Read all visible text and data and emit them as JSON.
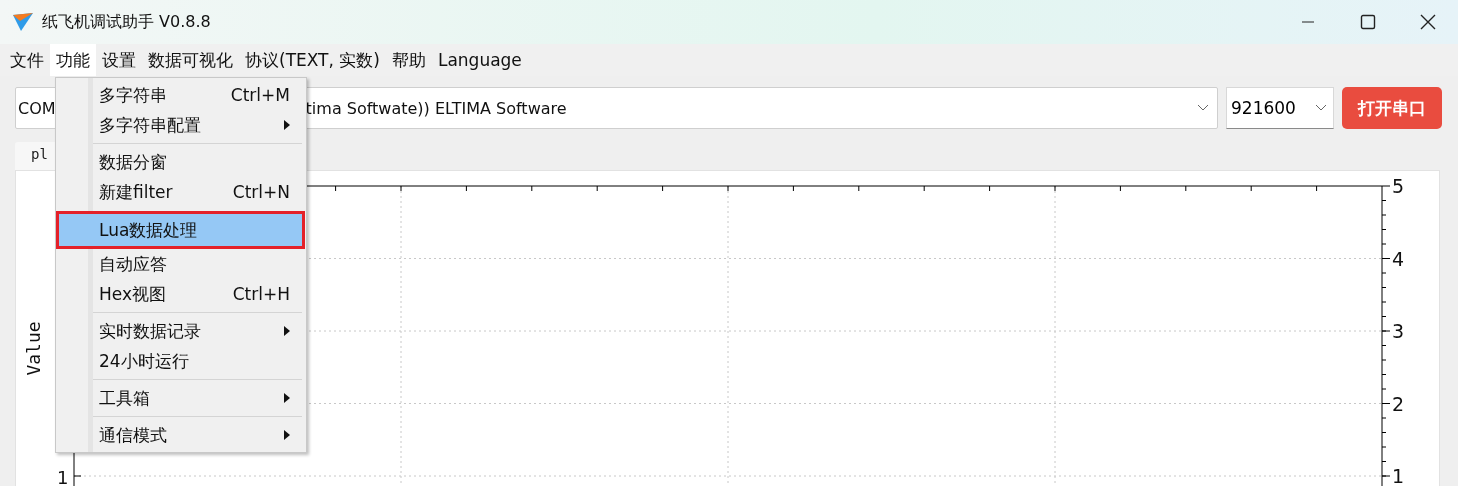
{
  "window": {
    "title": "纸飞机调试助手 V0.8.8"
  },
  "menu_bar": [
    {
      "label": "文件",
      "selected": false
    },
    {
      "label": "功能",
      "selected": true
    },
    {
      "label": "设置",
      "selected": false
    },
    {
      "label": "数据可视化",
      "selected": false
    },
    {
      "label": "协议(TEXT, 实数)",
      "selected": false
    },
    {
      "label": "帮助",
      "selected": false
    },
    {
      "label": "Language",
      "selected": false
    }
  ],
  "toolbar": {
    "port_value_start": "COM",
    "port_value_end": "tima Softwate)) ELTIMA Software",
    "baud_rate": "921600",
    "open_button": "打开串口"
  },
  "tabs": [
    {
      "label": "pl",
      "selected": true
    }
  ],
  "plot": {
    "y_axis_label": "Value",
    "right_axis_labels": [
      "5",
      "4",
      "3",
      "2",
      "1"
    ],
    "left_axis_labels": [
      "1"
    ]
  },
  "dropdown_menu": [
    {
      "kind": "item",
      "label": "多字符串",
      "shortcut": "Ctrl+M",
      "submenu": false,
      "selected": false
    },
    {
      "kind": "item",
      "label": "多字符串配置",
      "submenu": true,
      "selected": false
    },
    {
      "kind": "separator"
    },
    {
      "kind": "item",
      "label": "数据分窗",
      "submenu": false,
      "selected": false
    },
    {
      "kind": "item",
      "label": "新建filter",
      "shortcut": "Ctrl+N",
      "submenu": false,
      "selected": false
    },
    {
      "kind": "item",
      "label": "Lua数据处理",
      "submenu": false,
      "selected": true
    },
    {
      "kind": "item",
      "label": "自动应答",
      "submenu": false,
      "selected": false
    },
    {
      "kind": "item",
      "label": "Hex视图",
      "shortcut": "Ctrl+H",
      "submenu": false,
      "selected": false
    },
    {
      "kind": "separator"
    },
    {
      "kind": "item",
      "label": "实时数据记录",
      "submenu": true,
      "selected": false
    },
    {
      "kind": "item",
      "label": "24小时运行",
      "submenu": false,
      "selected": false
    },
    {
      "kind": "separator"
    },
    {
      "kind": "item",
      "label": "工具箱",
      "submenu": true,
      "selected": false
    },
    {
      "kind": "separator"
    },
    {
      "kind": "item",
      "label": "通信模式",
      "submenu": true,
      "selected": false
    }
  ]
}
